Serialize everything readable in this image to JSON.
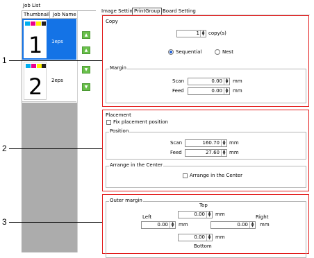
{
  "job_list": {
    "title": "Job List",
    "col_thumbnail": "Thumbnail",
    "col_job_name": "Job Name",
    "jobs": [
      {
        "number": "1",
        "name": "1eps",
        "selected": true
      },
      {
        "number": "2",
        "name": "2eps",
        "selected": false
      }
    ],
    "up_icon": "triangle-up-icon",
    "down_icon": "triangle-down-icon"
  },
  "tabs": [
    "Image Setting",
    "PrintGroup",
    "Board Setting"
  ],
  "copy": {
    "title": "Copy",
    "count": "1",
    "unit": "copy(s)",
    "sequential_label": "Sequential",
    "nest_label": "Nest",
    "selected_mode": "Sequential",
    "margin_title": "Margin",
    "scan_label": "Scan",
    "scan_value": "0.00",
    "feed_label": "Feed",
    "feed_value": "0.00",
    "unit_mm": "mm"
  },
  "placement": {
    "title": "Placement",
    "fix_label": "Fix placement position",
    "position_title": "Position",
    "scan_label": "Scan",
    "scan_value": "160.70",
    "feed_label": "Feed",
    "feed_value": "27.60",
    "unit_mm": "mm",
    "center_title": "Arrange in the Center",
    "center_label": "Arrange in the Center"
  },
  "outer_margin": {
    "title": "Outer margin",
    "top_label": "Top",
    "top_value": "0.00",
    "left_label": "Left",
    "left_value": "0.00",
    "right_label": "Right",
    "right_value": "0.00",
    "bottom_label": "Bottom",
    "bottom_value": "0.00",
    "unit_mm": "mm"
  },
  "callouts": [
    "1",
    "2",
    "3"
  ],
  "colors": {
    "selected_row": "#1473e6",
    "highlight_border": "#e21b1b",
    "arrow_button": "#69bf4a",
    "swatch_cyan": "#00aeef",
    "swatch_magenta": "#ec008c",
    "swatch_yellow": "#fff200",
    "swatch_black": "#231f20"
  }
}
